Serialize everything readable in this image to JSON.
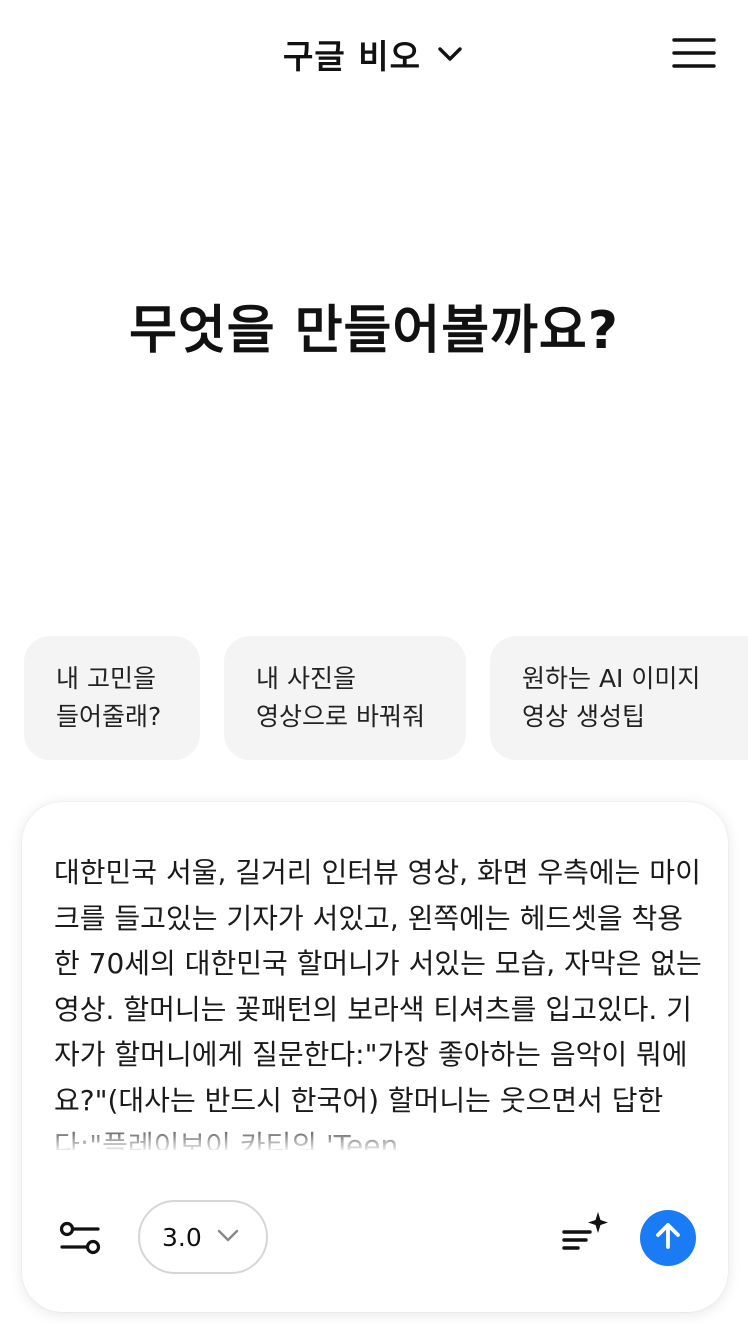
{
  "header": {
    "title": "구글 비오",
    "title_dropdown_icon": "chevron-down-icon",
    "menu_icon": "hamburger-menu-icon"
  },
  "main": {
    "headline": "무엇을 만들어볼까요?"
  },
  "suggestions": [
    {
      "line1": "내 고민을",
      "line2": "들어줄래?"
    },
    {
      "line1": "내 사진을",
      "line2": "영상으로 바꿔줘"
    },
    {
      "line1": "원하는 AI 이미지",
      "line2": "영상 생성팁"
    }
  ],
  "composer": {
    "prompt_text": "대한민국 서울, 길거리 인터뷰 영상, 화면 우측에는 마이크를 들고있는 기자가 서있고, 왼쪽에는 헤드셋을 착용한 70세의 대한민국 할머니가 서있는 모습, 자막은 없는 영상. 할머니는 꽃패턴의 보라색 티셔츠를 입고있다. 기자가 할머니에게 질문한다:\"가장 좋아하는 음악이 뭐에요?\"(대사는 반드시 한국어) 할머니는 웃으면서 답한다:\"플레이보이 카티의 'Teen",
    "settings_icon": "sliders-icon",
    "model_version": "3.0",
    "enhance_icon": "sparkle-lines-icon",
    "send_icon": "arrow-up-icon",
    "accent_color": "#1a7cf5"
  }
}
